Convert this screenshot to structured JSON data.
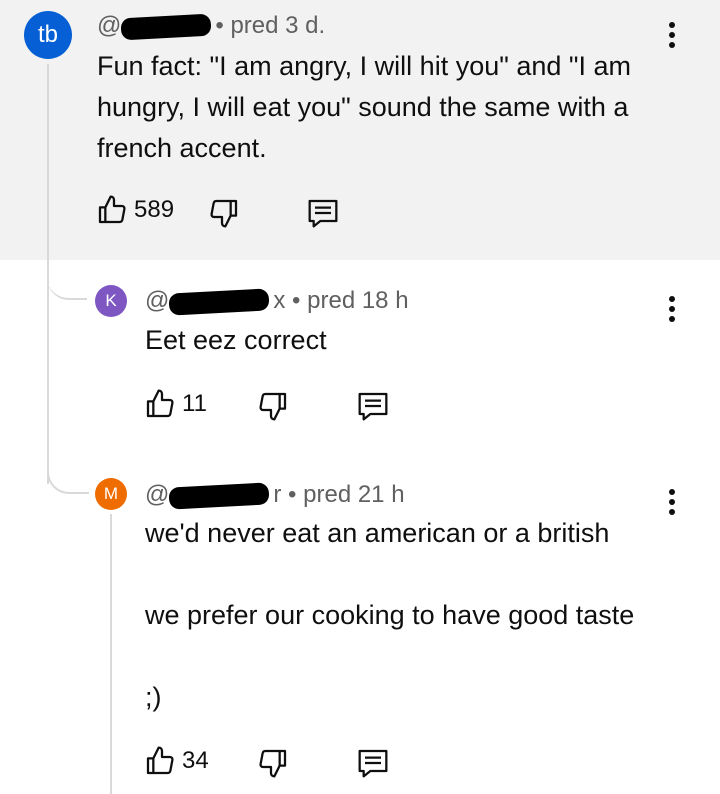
{
  "comments": [
    {
      "avatar_letter": "tb",
      "avatar_color": "#065fd4",
      "handle_visible": "@",
      "timestamp": "pred 3 d.",
      "text_lines": [
        "Fun fact: \"I am angry, I will hit you\" and \"I am",
        "hungry, I will eat you\" sound the same with a",
        "french accent."
      ],
      "likes": "589"
    },
    {
      "avatar_letter": "K",
      "avatar_color": "#7e57c2",
      "handle_visible": "@",
      "handle_tail": "x",
      "timestamp": "pred 18 h",
      "text_lines": [
        "Eet eez correct"
      ],
      "likes": "11"
    },
    {
      "avatar_letter": "M",
      "avatar_color": "#ef6c00",
      "handle_visible": "@",
      "handle_tail": "r",
      "timestamp": "pred 21 h",
      "text_lines": [
        "we'd never eat an american or a british",
        "",
        "we prefer our cooking to have good taste",
        "",
        ";)"
      ],
      "likes": "34"
    }
  ],
  "separator": "•",
  "icons": [
    "thumb-up-icon",
    "thumb-down-icon",
    "reply-icon",
    "more-vert-icon"
  ]
}
